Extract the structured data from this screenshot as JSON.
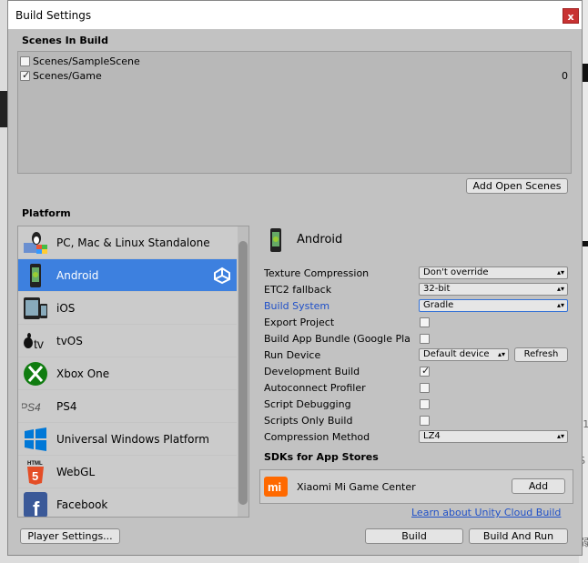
{
  "window": {
    "title": "Build Settings",
    "close_glyph": "x"
  },
  "scenes": {
    "heading": "Scenes In Build",
    "items": [
      {
        "label": "Scenes/SampleScene",
        "checked": false,
        "index": ""
      },
      {
        "label": "Scenes/Game",
        "checked": true,
        "index": "0"
      }
    ],
    "add_open_scenes_label": "Add Open Scenes"
  },
  "platform": {
    "heading": "Platform",
    "items": [
      {
        "label": "PC, Mac & Linux Standalone",
        "icon": "pc-mac-linux-icon",
        "selected": false
      },
      {
        "label": "Android",
        "icon": "android-icon",
        "selected": true
      },
      {
        "label": "iOS",
        "icon": "ios-device-icon",
        "selected": false
      },
      {
        "label": "tvOS",
        "icon": "appletv-icon",
        "selected": false
      },
      {
        "label": "Xbox One",
        "icon": "xbox-icon",
        "selected": false
      },
      {
        "label": "PS4",
        "icon": "ps4-icon",
        "selected": false
      },
      {
        "label": "Universal Windows Platform",
        "icon": "windows-icon",
        "selected": false
      },
      {
        "label": "WebGL",
        "icon": "html5-icon",
        "selected": false
      },
      {
        "label": "Facebook",
        "icon": "facebook-icon",
        "selected": false
      }
    ],
    "icon_text": {
      "tv": "tv",
      "ps4": "PS4",
      "html": "HTML",
      "html5": "5",
      "fb": "f"
    }
  },
  "settings": {
    "platform_title": "Android",
    "texture_compression": {
      "label": "Texture Compression",
      "value": "Don't override"
    },
    "etc2_fallback": {
      "label": "ETC2 fallback",
      "value": "32-bit"
    },
    "build_system": {
      "label": "Build System",
      "value": "Gradle"
    },
    "export_project": {
      "label": "Export Project",
      "checked": false
    },
    "build_app_bundle": {
      "label": "Build App Bundle (Google Pla",
      "checked": false
    },
    "run_device": {
      "label": "Run Device",
      "value": "Default device",
      "refresh_label": "Refresh"
    },
    "development_build": {
      "label": "Development Build",
      "checked": true
    },
    "autoconnect_profiler": {
      "label": "Autoconnect Profiler",
      "checked": false
    },
    "script_debugging": {
      "label": "Script Debugging",
      "checked": false
    },
    "scripts_only_build": {
      "label": "Scripts Only Build",
      "checked": false
    },
    "compression_method": {
      "label": "Compression Method",
      "value": "LZ4"
    },
    "dropdown_arrow": "▴▾"
  },
  "sdks": {
    "heading": "SDKs for App Stores",
    "item_label": "Xiaomi Mi Game Center",
    "item_logo": "mi",
    "add_label": "Add",
    "link_text": "Learn about Unity Cloud Build"
  },
  "footer": {
    "player_settings_label": "Player Settings...",
    "build_label": "Build",
    "build_and_run_label": "Build And Run"
  },
  "background": {
    "edge_text_1": "(1",
    "edge_text_2": "S",
    "edge_text_3": "弱"
  },
  "colors": {
    "window_bg": "#c2c2c2",
    "selection": "#3d80df",
    "link": "#1f50c8",
    "close_button": "#c83232"
  }
}
